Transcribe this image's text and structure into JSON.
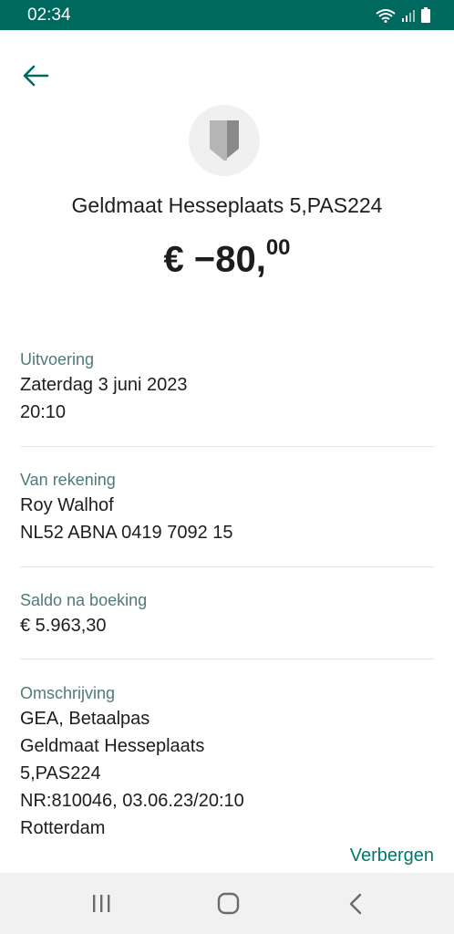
{
  "status_bar": {
    "time": "02:34"
  },
  "transaction": {
    "merchant": "Geldmaat Hesseplaats 5,PAS224",
    "amount_main": "€ −80,",
    "amount_cents": "00"
  },
  "details": {
    "execution": {
      "label": "Uitvoering",
      "lines": [
        "Zaterdag 3 juni 2023",
        "20:10"
      ]
    },
    "from_account": {
      "label": "Van rekening",
      "lines": [
        "Roy Walhof",
        "NL52 ABNA 0419 7092 15"
      ]
    },
    "balance": {
      "label": "Saldo na boeking",
      "lines": [
        "€ 5.963,30"
      ]
    },
    "description": {
      "label": "Omschrijving",
      "lines": [
        "GEA, Betaalpas",
        "Geldmaat Hesseplaats",
        "5,PAS224",
        "NR:810046, 03.06.23/20:10",
        "Rotterdam"
      ]
    }
  },
  "actions": {
    "hide_label": "Verbergen"
  },
  "colors": {
    "status_bar": "#00695f",
    "accent": "#00786d",
    "label": "#4f7a78"
  },
  "icons": {
    "back": "arrow-left-icon",
    "merchant": "shield-icon",
    "nav_recents": "recents-icon",
    "nav_home": "home-icon",
    "nav_back": "chevron-left-icon"
  }
}
